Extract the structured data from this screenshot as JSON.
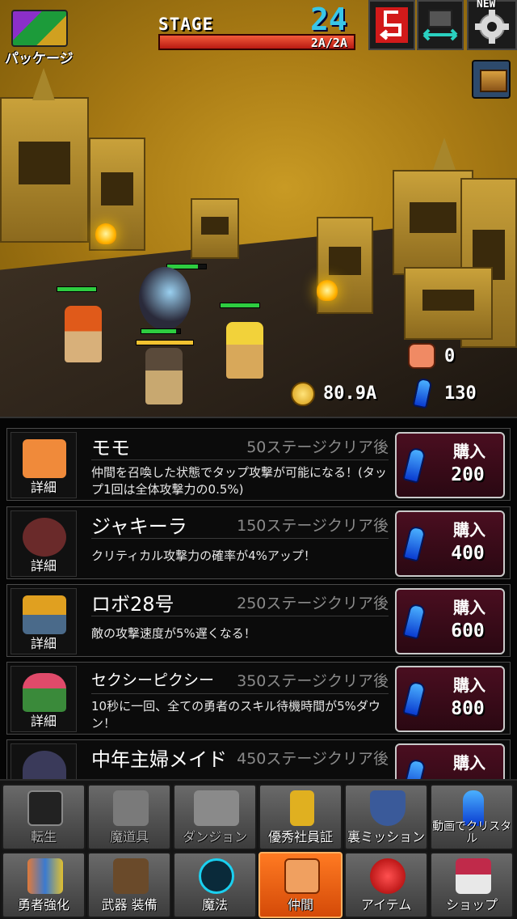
{
  "hud": {
    "package_label": "パッケージ",
    "stage_label": "STAGE",
    "stage_number": "24",
    "stage_progress": "2A/2A",
    "new_badge": "NEW"
  },
  "resources": {
    "coins": "80.9A",
    "crystals": "130",
    "paw_count": "0"
  },
  "companions": [
    {
      "name": "モモ",
      "requirement": "50ステージクリア後",
      "description": "仲間を召喚した状態でタップ攻撃が可能になる！(タップ1回は全体攻撃力の0.5%)",
      "detail": "詳細",
      "buy_label": "購入",
      "price": "200",
      "color": "#f08a3a"
    },
    {
      "name": "ジャキーラ",
      "requirement": "150ステージクリア後",
      "description": "クリティカル攻撃力の確率が4%アップ！",
      "detail": "詳細",
      "buy_label": "購入",
      "price": "400",
      "color": "#6a2a2a"
    },
    {
      "name": "ロボ28号",
      "requirement": "250ステージクリア後",
      "description": "敵の攻撃速度が5%遅くなる！",
      "detail": "詳細",
      "buy_label": "購入",
      "price": "600",
      "color": "#e0a020"
    },
    {
      "name": "セクシーピクシー",
      "requirement": "350ステージクリア後",
      "description": "10秒に一回、全ての勇者のスキル待機時間が5%ダウン！",
      "detail": "詳細",
      "buy_label": "購入",
      "price": "800",
      "color": "#e04a6a"
    },
    {
      "name": "中年主婦メイド",
      "requirement": "450ステージクリア後",
      "description": "",
      "detail": "",
      "buy_label": "購入",
      "price": "",
      "color": "#3a3a5a"
    }
  ],
  "menu": {
    "row1": [
      {
        "label": "転生",
        "icon": "silhouette-icon",
        "color": "#2a2a2a",
        "dim": true
      },
      {
        "label": "魔道具",
        "icon": "magic-tool-icon",
        "color": "#7a7a7a",
        "dim": true
      },
      {
        "label": "ダンジョン",
        "icon": "dungeon-icon",
        "color": "#8a8a8a",
        "dim": true
      },
      {
        "label": "優秀社員証",
        "icon": "badge-icon",
        "color": "#e0b020",
        "dim": false
      },
      {
        "label": "裏ミッション",
        "icon": "shield-icon",
        "color": "#3a5a9a",
        "dim": false
      },
      {
        "label": "動画でクリスタル",
        "icon": "crystal-icon",
        "color": "#2a7ae0",
        "dim": false
      }
    ],
    "row2": [
      {
        "label": "勇者強化",
        "icon": "heroes-icon",
        "color": "#e07a3a",
        "dim": false,
        "active": false
      },
      {
        "label": "武器 装備",
        "icon": "weapons-icon",
        "color": "#6a4a2a",
        "dim": false,
        "active": false
      },
      {
        "label": "魔法",
        "icon": "magic-circle-icon",
        "color": "#1aa0c0",
        "dim": false,
        "active": false
      },
      {
        "label": "仲間",
        "icon": "companion-cat-icon",
        "color": "#f0803a",
        "dim": false,
        "active": true
      },
      {
        "label": "アイテム",
        "icon": "potion-icon",
        "color": "#d02020",
        "dim": false,
        "active": false
      },
      {
        "label": "ショップ",
        "icon": "chest-icon",
        "color": "#c02a4a",
        "dim": false,
        "active": false
      }
    ]
  }
}
